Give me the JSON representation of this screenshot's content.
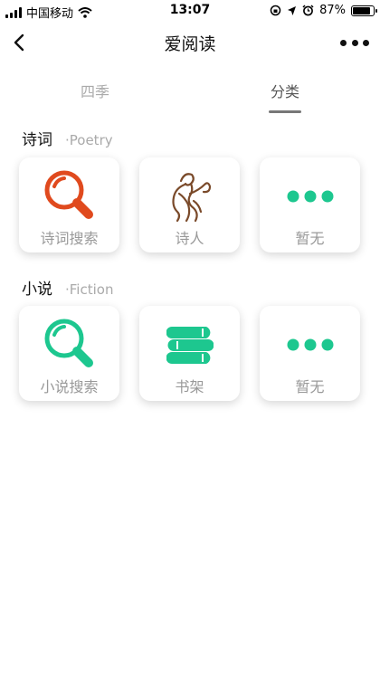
{
  "status_bar": {
    "carrier": "中国移动",
    "time": "13:07",
    "battery": "87%",
    "battery_level": 0.87
  },
  "nav": {
    "title": "爱阅读",
    "back_icon": "chevron-left-icon",
    "more_icon": "more-dots-icon"
  },
  "tabs": [
    {
      "label": "四季"
    },
    {
      "label": "分类",
      "active": true
    }
  ],
  "sections": [
    {
      "title": "诗词",
      "subtitle": "·Poetry",
      "cards": [
        {
          "label": "诗词搜索",
          "icon": "search-icon",
          "color": "#E04A1E"
        },
        {
          "label": "诗人",
          "icon": "poet-icon",
          "color": "#7A4A2A"
        },
        {
          "label": "暂无",
          "icon": "dots-icon",
          "color": "#1DC78F"
        }
      ]
    },
    {
      "title": "小说",
      "subtitle": "·Fiction",
      "cards": [
        {
          "label": "小说搜索",
          "icon": "search-icon",
          "color": "#1DC78F"
        },
        {
          "label": "书架",
          "icon": "bookshelf-icon",
          "color": "#1DC78F"
        },
        {
          "label": "暂无",
          "icon": "dots-icon",
          "color": "#1DC78F"
        }
      ]
    }
  ]
}
